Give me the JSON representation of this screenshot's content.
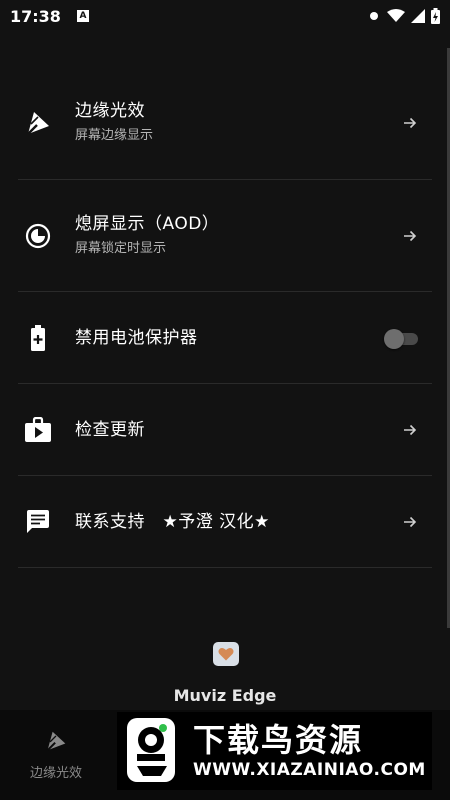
{
  "status_bar": {
    "time": "17:38",
    "badge": "A"
  },
  "menu": {
    "items": [
      {
        "title": "边缘光效",
        "subtitle": "屏幕边缘显示",
        "icon": "edge-light-icon",
        "control": "arrow"
      },
      {
        "title": "熄屏显示（AOD）",
        "subtitle": "屏幕锁定时显示",
        "icon": "clock-icon",
        "control": "arrow"
      },
      {
        "title": "禁用电池保护器",
        "subtitle": "",
        "icon": "battery-icon",
        "control": "toggle",
        "toggle_on": false
      },
      {
        "title": "检查更新",
        "subtitle": "",
        "icon": "store-icon",
        "control": "arrow"
      },
      {
        "title": "联系支持　★予澄 汉化★",
        "subtitle": "",
        "icon": "chat-icon",
        "control": "arrow"
      }
    ]
  },
  "app": {
    "name": "Muviz Edge",
    "badge_icon": "heart-icon"
  },
  "bottom_nav": {
    "tabs": [
      {
        "label": "边缘光效",
        "icon": "edge-light-icon"
      }
    ]
  },
  "watermark": {
    "title": "下载鸟资源",
    "url": "WWW.XIAZAINIAO.COM"
  },
  "colors": {
    "background": "#121212",
    "accent": "#d58a55",
    "divider": "#2a2a2a"
  }
}
